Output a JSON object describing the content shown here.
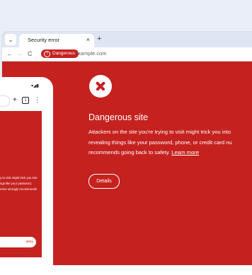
{
  "desktop": {
    "tab": {
      "title": "Security error",
      "close": "×"
    },
    "new_tab": "+",
    "nav": {
      "back": "←",
      "forward": "→",
      "reload": "C"
    },
    "security_chip": {
      "label": "Dangerous",
      "icon": "warning-icon"
    },
    "url": "example.com",
    "interstitial": {
      "icon": "error-x-icon",
      "heading": "Dangerous site",
      "body_lines": [
        "Attackers on the site you're trying to visit might trick you into",
        "revealing things like your password, phone, or credit card nu",
        "recommends going back to safety."
      ],
      "learn_more": "Learn more",
      "details_button": "Details"
    }
  },
  "mobile": {
    "status_icons": "▾◢▮",
    "toolbar": {
      "new_tab": "+",
      "tab_count": "1",
      "menu": "⋮"
    },
    "body_lines": [
      "y to visit might trick you into",
      "ngs like your password,",
      "rome strongly recommends"
    ],
    "back_button": "afety"
  },
  "colors": {
    "danger_red": "#c5221f",
    "backdrop": "#e9eef8",
    "white": "#ffffff"
  }
}
